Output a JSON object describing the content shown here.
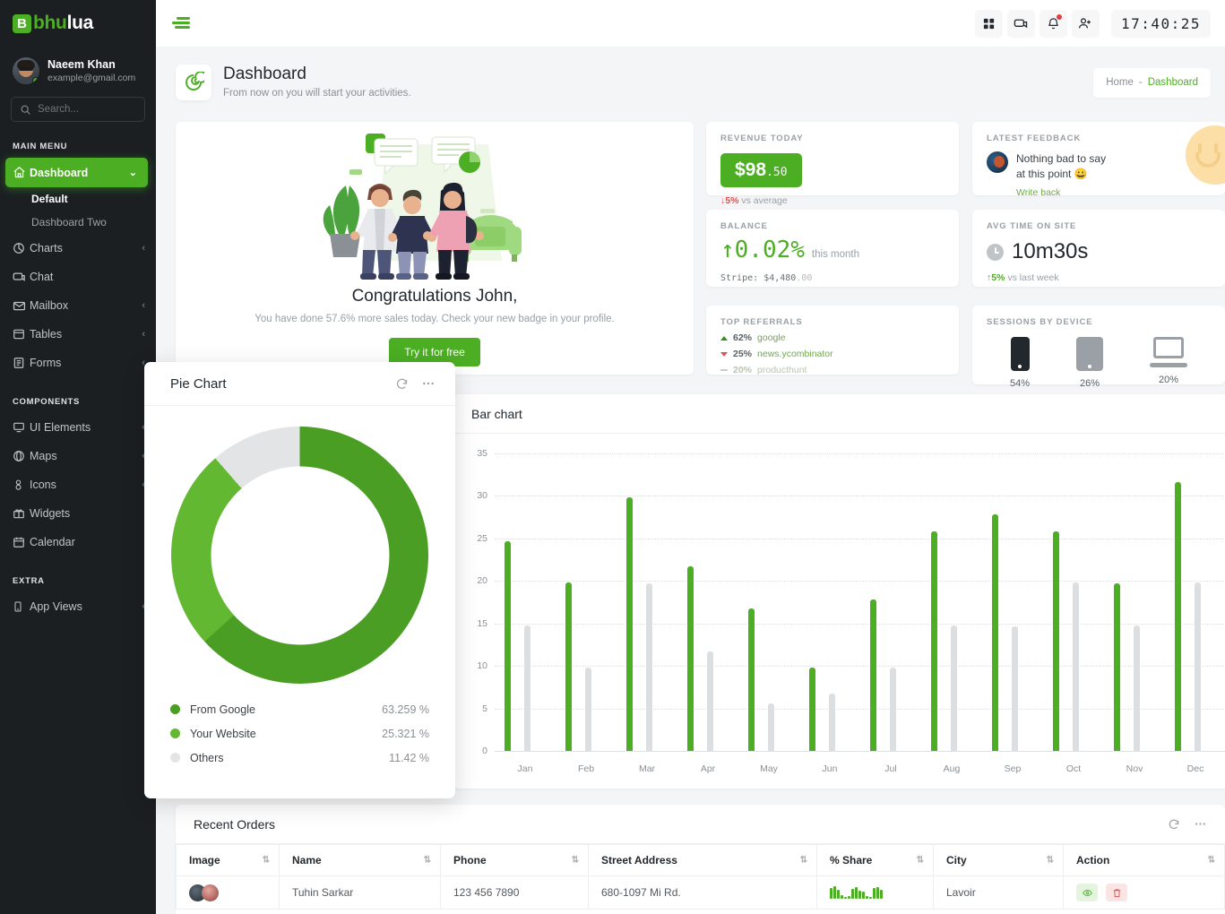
{
  "brand": {
    "mark": "B",
    "name_green": "bhu",
    "name_white": "lua"
  },
  "profile": {
    "name": "Naeem Khan",
    "email": "example@gmail.com"
  },
  "search": {
    "placeholder": "Search..."
  },
  "sidebar": {
    "main_label": "MAIN MENU",
    "components_label": "COMPONENTS",
    "extra_label": "EXTRA",
    "main_items": [
      {
        "label": "Dashboard",
        "icon": "home-icon",
        "active": true,
        "chevron": "⌄"
      },
      {
        "label": "Charts",
        "icon": "chart-icon",
        "chevron": "‹"
      },
      {
        "label": "Chat",
        "icon": "chat-icon",
        "chevron": ""
      },
      {
        "label": "Mailbox",
        "icon": "mail-icon",
        "chevron": "‹"
      },
      {
        "label": "Tables",
        "icon": "table-icon",
        "chevron": "‹"
      },
      {
        "label": "Forms",
        "icon": "form-icon",
        "chevron": "‹"
      }
    ],
    "sub_items": [
      {
        "label": "Default",
        "current": true
      },
      {
        "label": "Dashboard Two",
        "current": false
      }
    ],
    "component_items": [
      {
        "label": "UI Elements",
        "icon": "ui-icon",
        "chevron": "‹"
      },
      {
        "label": "Maps",
        "icon": "globe-icon",
        "chevron": "‹"
      },
      {
        "label": "Icons",
        "icon": "icons-icon",
        "chevron": "‹"
      },
      {
        "label": "Widgets",
        "icon": "gift-icon",
        "chevron": ""
      },
      {
        "label": "Calendar",
        "icon": "calendar-icon",
        "chevron": ""
      }
    ],
    "extra_items": [
      {
        "label": "App Views",
        "icon": "phone-icon",
        "chevron": "‹"
      }
    ]
  },
  "topbar": {
    "clock": "17:40:25",
    "icons": [
      "grid-icon",
      "chat-icon",
      "bell-icon",
      "add-user-icon"
    ]
  },
  "page": {
    "title": "Dashboard",
    "subtitle": "From now on you will start your activities.",
    "breadcrumb_home": "Home",
    "breadcrumb_sep": "-",
    "breadcrumb_current": "Dashboard"
  },
  "congrats": {
    "heading": "Congratulations John,",
    "text": "You have done 57.6% more sales today. Check your new badge in your profile.",
    "button": "Try it for free"
  },
  "revenue": {
    "title": "REVENUE TODAY",
    "amount_big": "$98",
    "amount_small": ".50",
    "delta": "5%",
    "delta_note": "vs average"
  },
  "balance": {
    "title": "BALANCE",
    "value": "↑0.02%",
    "period": "this month",
    "stripe_label": "Stripe:",
    "stripe_value": "$4,480",
    "stripe_cents": ".00"
  },
  "referrals": {
    "title": "TOP REFERRALS",
    "rows": [
      {
        "dir": "up",
        "pct": "62%",
        "name": "google"
      },
      {
        "dir": "down",
        "pct": "25%",
        "name": "news.ycombinator"
      },
      {
        "dir": "flat",
        "pct": "20%",
        "name": "producthunt"
      }
    ]
  },
  "feedback": {
    "title": "LATEST FEEDBACK",
    "line1": "Nothing bad to say",
    "line2": "at this point 😀",
    "action": "Write back"
  },
  "avg_time": {
    "title": "AVG TIME ON SITE",
    "value": "10m30s",
    "delta": "5%",
    "delta_note": "vs last week"
  },
  "sessions": {
    "title": "SESSIONS BY DEVICE",
    "devices": [
      {
        "icon": "phone-device-icon",
        "pct": "54%"
      },
      {
        "icon": "tablet-device-icon",
        "pct": "26%"
      },
      {
        "icon": "laptop-device-icon",
        "pct": "20%"
      }
    ]
  },
  "pie_card": {
    "title": "Pie Chart",
    "refresh_icon": "refresh-icon",
    "more_icon": "more-icon"
  },
  "orders": {
    "title": "Recent Orders",
    "refresh_icon": "refresh-icon",
    "more_icon": "more-icon",
    "columns": [
      "Image",
      "Name",
      "Phone",
      "Street Address",
      "% Share",
      "City",
      "Action"
    ],
    "rows": [
      {
        "name": "Tuhin Sarkar",
        "phone": "123 456 7890",
        "address": "680-1097 Mi Rd.",
        "city": "Lavoir",
        "share": [
          11,
          13,
          9,
          4,
          2,
          3,
          10,
          12,
          8,
          7,
          3,
          2,
          11,
          12,
          9
        ],
        "view_icon": "eye-icon",
        "delete_icon": "trash-icon"
      }
    ]
  },
  "chart_data": [
    {
      "type": "pie",
      "title": "Pie Chart",
      "labels": [
        "From Google",
        "Your Website",
        "Others"
      ],
      "values": [
        63.259,
        25.321,
        11.42
      ],
      "value_labels": [
        "63.259 %",
        "25.321 %",
        "11.42 %"
      ],
      "colors": [
        "#4a9e23",
        "#63b832",
        "#e2e4e6"
      ],
      "legend": "bottom"
    },
    {
      "type": "bar",
      "title": "Bar chart",
      "categories": [
        "Jan",
        "Feb",
        "Mar",
        "Apr",
        "May",
        "Jun",
        "Jul",
        "Aug",
        "Sep",
        "Oct",
        "Nov",
        "Dec"
      ],
      "series": [
        {
          "name": "green",
          "color": "#4caf23",
          "values": [
            24.7,
            19.8,
            29.8,
            21.7,
            16.8,
            9.8,
            17.8,
            25.8,
            27.8,
            25.8,
            19.7,
            31.6
          ]
        },
        {
          "name": "grey",
          "color": "#dcdfe2",
          "values": [
            14.8,
            9.8,
            19.7,
            11.7,
            5.6,
            6.7,
            9.8,
            14.8,
            14.7,
            19.8,
            14.8,
            19.8
          ]
        }
      ],
      "yticks": [
        0,
        5,
        10,
        15,
        20,
        25,
        30,
        35
      ],
      "ylim": [
        0,
        35
      ],
      "xlabel": "",
      "ylabel": "",
      "grid": true,
      "legend": "none"
    }
  ]
}
